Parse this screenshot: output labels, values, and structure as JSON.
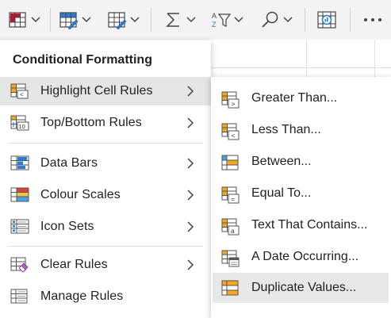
{
  "ribbon": {
    "buttons": [
      {
        "name": "conditional-formatting-ribbon-button",
        "icon": "conditional-formatting-icon"
      },
      {
        "name": "format-as-table-ribbon-button",
        "icon": "format-as-table-icon"
      },
      {
        "name": "cell-styles-ribbon-button",
        "icon": "cell-styles-icon"
      },
      {
        "name": "autosum-ribbon-button",
        "icon": "sigma-icon"
      },
      {
        "name": "sort-filter-ribbon-button",
        "icon": "sort-filter-icon"
      },
      {
        "name": "find-select-ribbon-button",
        "icon": "search-icon"
      },
      {
        "name": "analyze-data-ribbon-button",
        "icon": "analyze-data-icon"
      },
      {
        "name": "more-options-ribbon-button",
        "icon": "more-icon"
      }
    ]
  },
  "menu": {
    "title": "Conditional Formatting",
    "items": [
      {
        "label": "Highlight Cell Rules",
        "icon": "highlight-cell-rules-icon",
        "submenu": true
      },
      {
        "label": "Top/Bottom Rules",
        "icon": "top-bottom-rules-icon",
        "submenu": true
      },
      {
        "label": "Data Bars",
        "icon": "data-bars-icon",
        "submenu": true
      },
      {
        "label": "Colour Scales",
        "icon": "colour-scales-icon",
        "submenu": true
      },
      {
        "label": "Icon Sets",
        "icon": "icon-sets-icon",
        "submenu": true
      },
      {
        "label": "Clear Rules",
        "icon": "clear-rules-icon",
        "submenu": true
      },
      {
        "label": "Manage Rules",
        "icon": "manage-rules-icon",
        "submenu": false
      }
    ]
  },
  "submenu": {
    "items": [
      {
        "label": "Greater Than...",
        "icon": "greater-than-icon"
      },
      {
        "label": "Less Than...",
        "icon": "less-than-icon"
      },
      {
        "label": "Between...",
        "icon": "between-icon"
      },
      {
        "label": "Equal To...",
        "icon": "equal-to-icon"
      },
      {
        "label": "Text That Contains...",
        "icon": "text-contains-icon"
      },
      {
        "label": "A Date Occurring...",
        "icon": "date-occurring-icon"
      },
      {
        "label": "Duplicate Values...",
        "icon": "duplicate-values-icon"
      }
    ]
  },
  "colors": {
    "accent_blue": "#2b7cd3",
    "highlight_orange": "#f5a623",
    "ribbon_bg": "#f3f3f3",
    "hover_bg": "#e5e5e5"
  }
}
